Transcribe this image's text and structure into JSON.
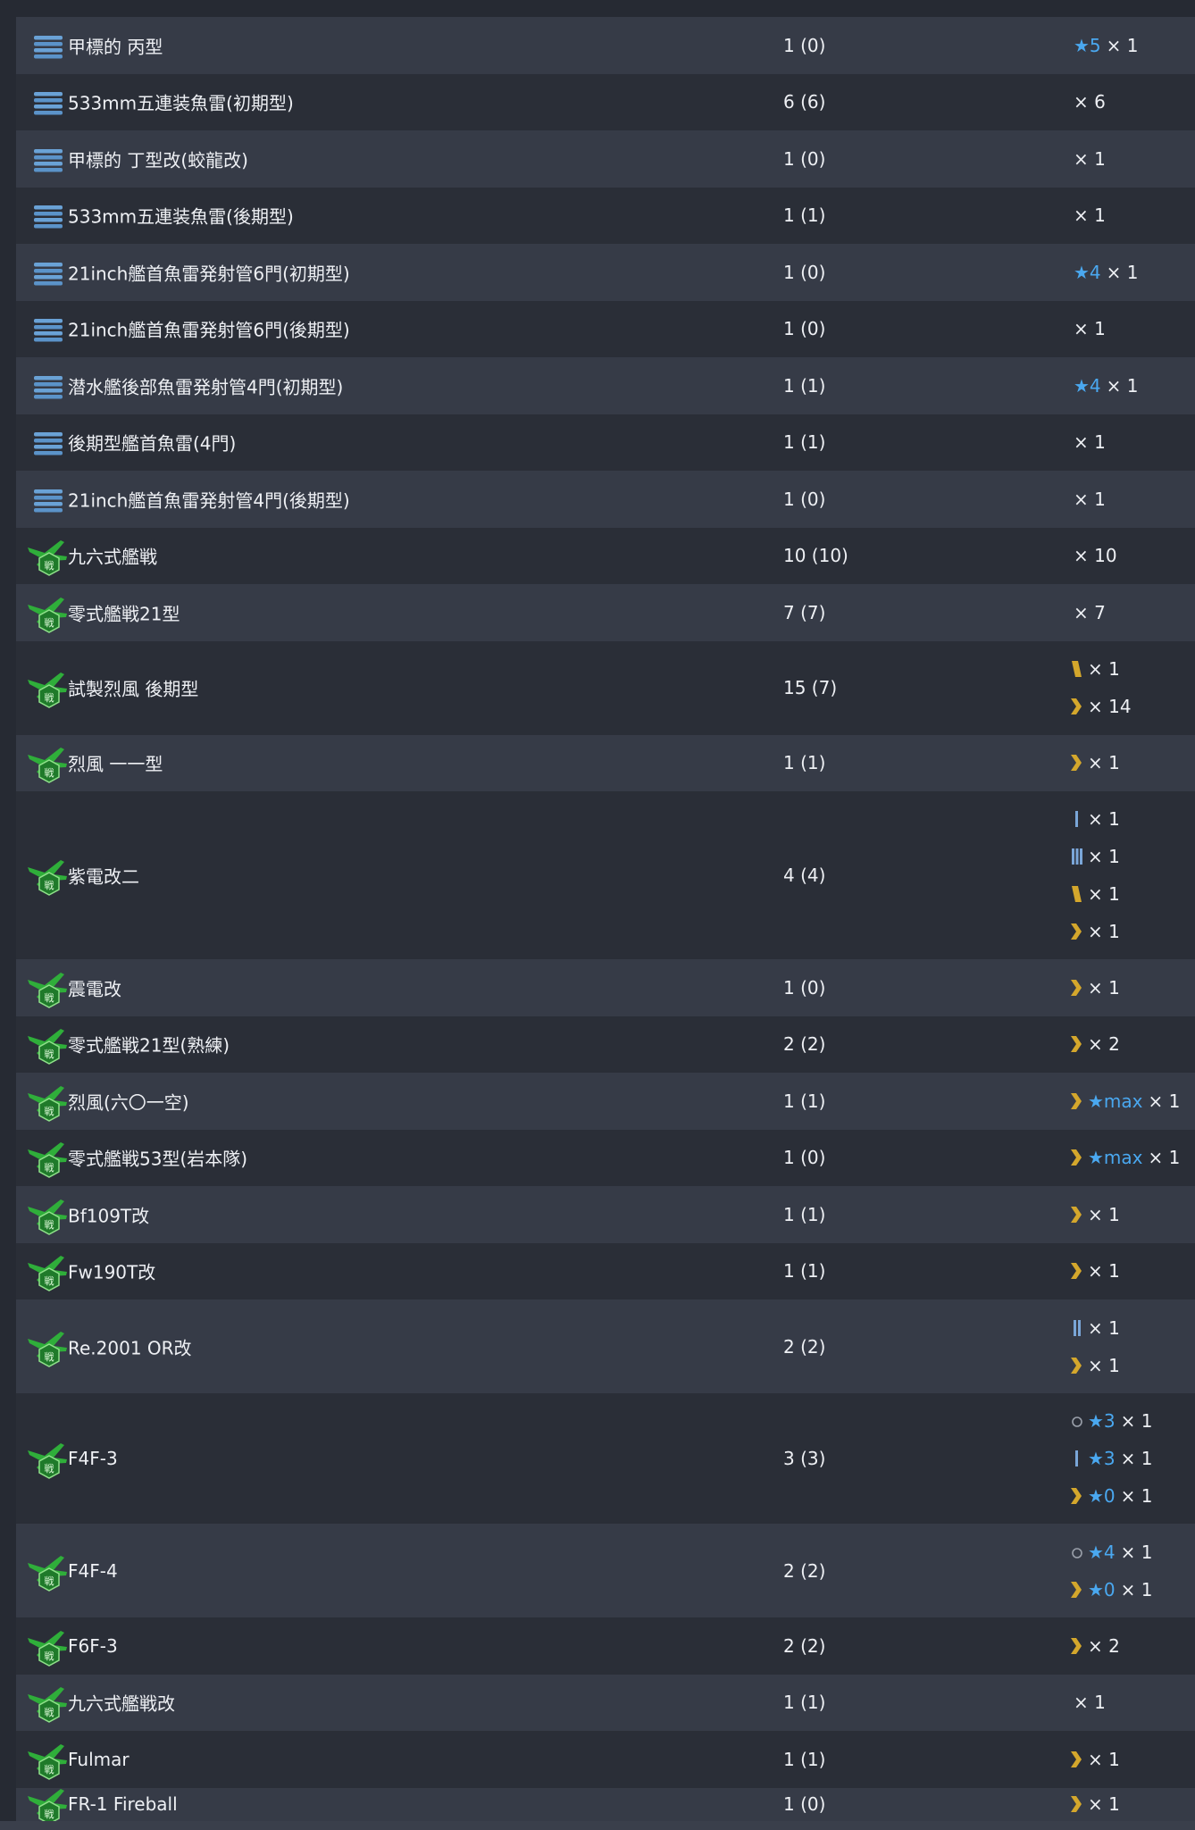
{
  "rows": [
    {
      "name": "甲標的 丙型",
      "type": "torpedo",
      "count": "1 (0)",
      "counts": [
        {
          "badge": "",
          "star": "★5",
          "times": "× 1"
        }
      ]
    },
    {
      "name": "533mm五連装魚雷(初期型)",
      "type": "torpedo",
      "count": "6 (6)",
      "counts": [
        {
          "badge": "",
          "star": "",
          "times": "× 6"
        }
      ]
    },
    {
      "name": "甲標的 丁型改(蛟龍改)",
      "type": "torpedo",
      "count": "1 (0)",
      "counts": [
        {
          "badge": "",
          "star": "",
          "times": "× 1"
        }
      ]
    },
    {
      "name": "533mm五連装魚雷(後期型)",
      "type": "torpedo",
      "count": "1 (1)",
      "counts": [
        {
          "badge": "",
          "star": "",
          "times": "× 1"
        }
      ]
    },
    {
      "name": "21inch艦首魚雷発射管6門(初期型)",
      "type": "torpedo",
      "count": "1 (0)",
      "counts": [
        {
          "badge": "",
          "star": "★4",
          "times": "× 1"
        }
      ]
    },
    {
      "name": "21inch艦首魚雷発射管6門(後期型)",
      "type": "torpedo",
      "count": "1 (0)",
      "counts": [
        {
          "badge": "",
          "star": "",
          "times": "× 1"
        }
      ]
    },
    {
      "name": "潜水艦後部魚雷発射管4門(初期型)",
      "type": "torpedo",
      "count": "1 (1)",
      "counts": [
        {
          "badge": "",
          "star": "★4",
          "times": "× 1"
        }
      ]
    },
    {
      "name": "後期型艦首魚雷(4門)",
      "type": "torpedo",
      "count": "1 (1)",
      "counts": [
        {
          "badge": "",
          "star": "",
          "times": "× 1"
        }
      ]
    },
    {
      "name": "21inch艦首魚雷発射管4門(後期型)",
      "type": "torpedo",
      "count": "1 (0)",
      "counts": [
        {
          "badge": "",
          "star": "",
          "times": "× 1"
        }
      ]
    },
    {
      "name": "九六式艦戦",
      "type": "fighter",
      "count": "10 (10)",
      "counts": [
        {
          "badge": "",
          "star": "",
          "times": "× 10"
        }
      ]
    },
    {
      "name": "零式艦戦21型",
      "type": "fighter",
      "count": "7 (7)",
      "counts": [
        {
          "badge": "",
          "star": "",
          "times": "× 7"
        }
      ]
    },
    {
      "name": "試製烈風 後期型",
      "type": "fighter",
      "count": "15 (7)",
      "counts": [
        {
          "badge": "yellow-bar",
          "star": "",
          "times": "× 1"
        },
        {
          "badge": "chevron",
          "star": "",
          "times": "× 14"
        }
      ]
    },
    {
      "name": "烈風 一一型",
      "type": "fighter",
      "count": "1 (1)",
      "counts": [
        {
          "badge": "chevron",
          "star": "",
          "times": "× 1"
        }
      ]
    },
    {
      "name": "紫電改二",
      "type": "fighter",
      "count": "4 (4)",
      "counts": [
        {
          "badge": "blue-1",
          "star": "",
          "times": "× 1"
        },
        {
          "badge": "blue-3",
          "star": "",
          "times": "× 1"
        },
        {
          "badge": "yellow-bar",
          "star": "",
          "times": "× 1"
        },
        {
          "badge": "chevron",
          "star": "",
          "times": "× 1"
        }
      ]
    },
    {
      "name": "震電改",
      "type": "fighter",
      "count": "1 (0)",
      "counts": [
        {
          "badge": "chevron",
          "star": "",
          "times": "× 1"
        }
      ]
    },
    {
      "name": "零式艦戦21型(熟練)",
      "type": "fighter",
      "count": "2 (2)",
      "counts": [
        {
          "badge": "chevron",
          "star": "",
          "times": "× 2"
        }
      ]
    },
    {
      "name": "烈風(六〇一空)",
      "type": "fighter",
      "count": "1 (1)",
      "counts": [
        {
          "badge": "chevron",
          "star": "★max",
          "times": "× 1"
        }
      ]
    },
    {
      "name": "零式艦戦53型(岩本隊)",
      "type": "fighter",
      "count": "1 (0)",
      "counts": [
        {
          "badge": "chevron",
          "star": "★max",
          "times": "× 1"
        }
      ]
    },
    {
      "name": "Bf109T改",
      "type": "fighter",
      "count": "1 (1)",
      "counts": [
        {
          "badge": "chevron",
          "star": "",
          "times": "× 1"
        }
      ]
    },
    {
      "name": "Fw190T改",
      "type": "fighter",
      "count": "1 (1)",
      "counts": [
        {
          "badge": "chevron",
          "star": "",
          "times": "× 1"
        }
      ]
    },
    {
      "name": "Re.2001 OR改",
      "type": "fighter",
      "count": "2 (2)",
      "counts": [
        {
          "badge": "blue-2",
          "star": "",
          "times": "× 1"
        },
        {
          "badge": "chevron",
          "star": "",
          "times": "× 1"
        }
      ]
    },
    {
      "name": "F4F-3",
      "type": "fighter",
      "count": "3 (3)",
      "counts": [
        {
          "badge": "circle",
          "star": "★3",
          "times": "× 1"
        },
        {
          "badge": "blue-1",
          "star": "★3",
          "times": "× 1"
        },
        {
          "badge": "chevron",
          "star": "★0",
          "times": "× 1"
        }
      ]
    },
    {
      "name": "F4F-4",
      "type": "fighter",
      "count": "2 (2)",
      "counts": [
        {
          "badge": "circle",
          "star": "★4",
          "times": "× 1"
        },
        {
          "badge": "chevron",
          "star": "★0",
          "times": "× 1"
        }
      ]
    },
    {
      "name": "F6F-3",
      "type": "fighter",
      "count": "2 (2)",
      "counts": [
        {
          "badge": "chevron",
          "star": "",
          "times": "× 2"
        }
      ]
    },
    {
      "name": "九六式艦戦改",
      "type": "fighter",
      "count": "1 (1)",
      "counts": [
        {
          "badge": "",
          "star": "",
          "times": "× 1"
        }
      ]
    },
    {
      "name": "Fulmar",
      "type": "fighter",
      "count": "1 (1)",
      "counts": [
        {
          "badge": "chevron",
          "star": "",
          "times": "× 1"
        }
      ]
    },
    {
      "name": "FR-1 Fireball",
      "type": "fighter",
      "count": "1 (0)",
      "counts": [
        {
          "badge": "chevron",
          "star": "",
          "times": "× 1"
        }
      ]
    }
  ]
}
